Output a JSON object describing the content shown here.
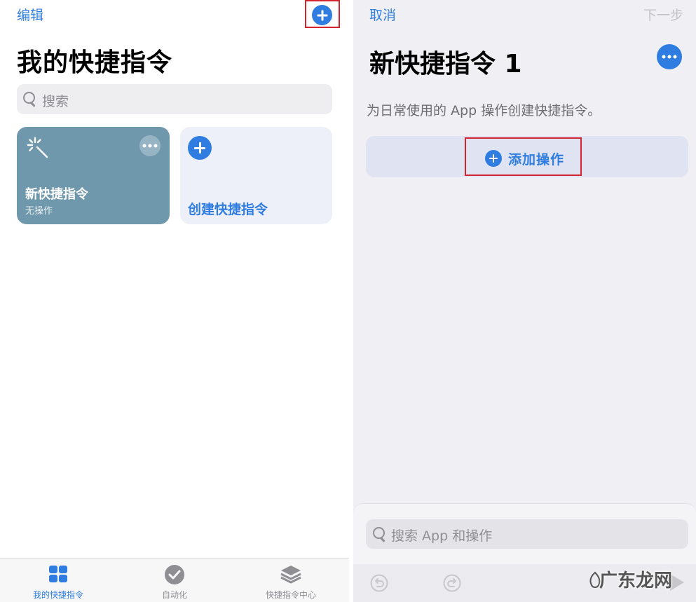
{
  "left": {
    "nav": {
      "edit_label": "编辑"
    },
    "title": "我的快捷指令",
    "search": {
      "placeholder": "搜索"
    },
    "cards": {
      "shortcut": {
        "title": "新快捷指令",
        "subtitle": "无操作"
      },
      "create": {
        "label": "创建快捷指令"
      }
    },
    "tabs": [
      {
        "label": "我的快捷指令",
        "icon": "grid-icon",
        "active": true
      },
      {
        "label": "自动化",
        "icon": "checkmark-clock-icon",
        "active": false
      },
      {
        "label": "快捷指令中心",
        "icon": "layers-icon",
        "active": false
      }
    ]
  },
  "right": {
    "nav": {
      "cancel_label": "取消",
      "next_label": "下一步"
    },
    "title": "新快捷指令 1",
    "description": "为日常使用的 App 操作创建快捷指令。",
    "add_action_label": "添加操作",
    "sheet": {
      "search_placeholder": "搜索 App 和操作"
    }
  },
  "watermark": "广东龙网",
  "colors": {
    "accent": "#2f7de1",
    "highlight_border": "#d4252f",
    "shortcut_card": "#6f98ad",
    "create_card": "#eef0f9",
    "editor_background": "#efeff4"
  }
}
